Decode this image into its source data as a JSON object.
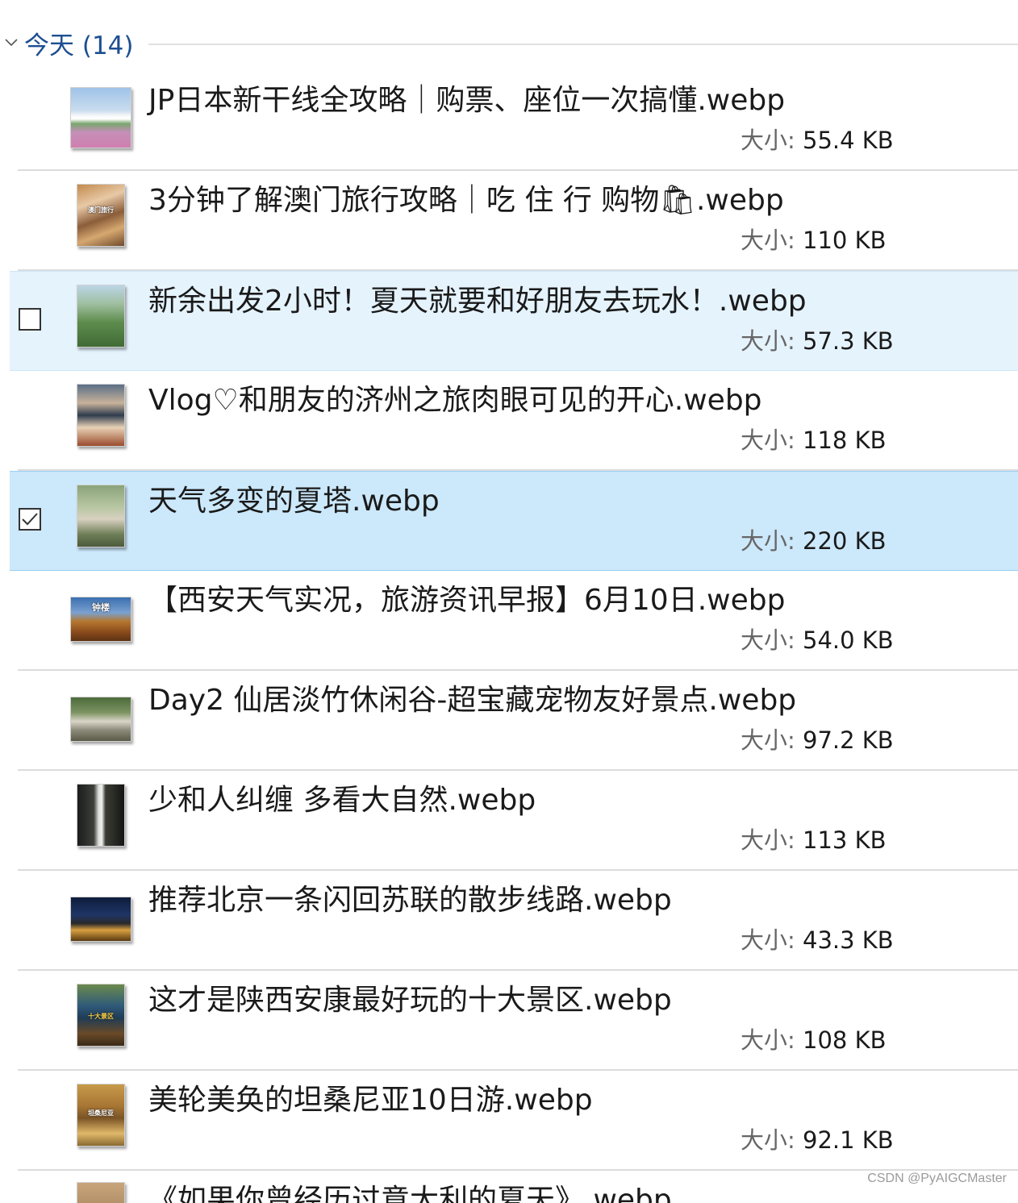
{
  "group": {
    "title": "今天 (14)",
    "collapse_icon": "chevron-down-icon"
  },
  "files": [
    {
      "name": "JP日本新干线全攻略｜购票、座位一次搞懂.webp",
      "size_label": "大小:",
      "size": "55.4 KB",
      "state": "normal",
      "thumb": "landscape"
    },
    {
      "name": "3分钟了解澳门旅行攻略｜吃 住 行 购物🛍.webp",
      "size_label": "大小:",
      "size": "110 KB",
      "state": "normal",
      "thumb": "portrait"
    },
    {
      "name": "新余出发2小时！夏天就要和好朋友去玩水！.webp",
      "size_label": "大小:",
      "size": "57.3 KB",
      "state": "hover",
      "thumb": "portrait"
    },
    {
      "name": "Vlog♡和朋友的济州之旅肉眼可见的开心.webp",
      "size_label": "大小:",
      "size": "118 KB",
      "state": "normal",
      "thumb": "portrait"
    },
    {
      "name": "天气多变的夏塔.webp",
      "size_label": "大小:",
      "size": "220 KB",
      "state": "selected",
      "thumb": "portrait"
    },
    {
      "name": "【西安天气实况，旅游资讯早报】6月10日.webp",
      "size_label": "大小:",
      "size": "54.0 KB",
      "state": "normal",
      "thumb": "wide"
    },
    {
      "name": "Day2 仙居淡竹休闲谷-超宝藏宠物友好景点.webp",
      "size_label": "大小:",
      "size": "97.2 KB",
      "state": "normal",
      "thumb": "wide"
    },
    {
      "name": "少和人纠缠 多看大自然.webp",
      "size_label": "大小:",
      "size": "113 KB",
      "state": "normal",
      "thumb": "portrait"
    },
    {
      "name": "推荐北京一条闪回苏联的散步线路.webp",
      "size_label": "大小:",
      "size": "43.3 KB",
      "state": "normal",
      "thumb": "wide"
    },
    {
      "name": "这才是陕西安康最好玩的十大景区.webp",
      "size_label": "大小:",
      "size": "108 KB",
      "state": "normal",
      "thumb": "portrait"
    },
    {
      "name": "美轮美奂的坦桑尼亚10日游.webp",
      "size_label": "大小:",
      "size": "92.1 KB",
      "state": "normal",
      "thumb": "portrait"
    }
  ],
  "partial_file": {
    "name": "《如果你曾经历过意大利的夏天》.webp"
  },
  "thumb_text": {
    "macau": "澳门旅行",
    "xian": "钟楼",
    "ankang": "十大景区",
    "tanzania": "坦桑尼亚"
  },
  "watermark": "CSDN @PyAIGCMaster"
}
